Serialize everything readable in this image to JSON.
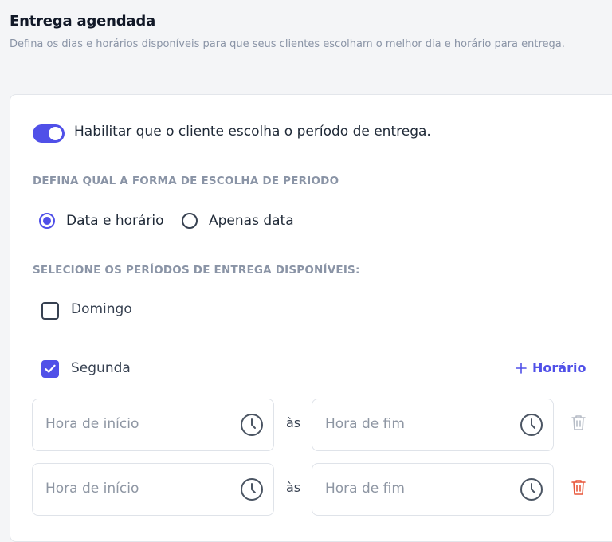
{
  "header": {
    "title": "Entrega agendada",
    "description": "Defina os dias e horários disponíveis para que seus clientes escolham o melhor dia e horário para entrega."
  },
  "toggle": {
    "label": "Habilitar que o cliente escolha o período de entrega.",
    "enabled": true
  },
  "period_form": {
    "heading": "DEFINA QUAL A FORMA DE ESCOLHA DE PERIODO",
    "options": [
      {
        "label": "Data e horário",
        "selected": true
      },
      {
        "label": "Apenas data",
        "selected": false
      }
    ]
  },
  "periods": {
    "heading": "SELECIONE OS PERÍODOS DE ENTREGA DISPONÍVEIS:",
    "days": [
      {
        "label": "Domingo",
        "checked": false
      },
      {
        "label": "Segunda",
        "checked": true
      }
    ],
    "add_time_label": "Horário",
    "time_rows": [
      {
        "start_placeholder": "Hora de início",
        "separator": "às",
        "end_placeholder": "Hora de fim",
        "delete_enabled": false
      },
      {
        "start_placeholder": "Hora de início",
        "separator": "às",
        "end_placeholder": "Hora de fim",
        "delete_enabled": true
      }
    ]
  },
  "colors": {
    "accent": "#5050e8",
    "danger": "#e8573a",
    "muted": "#8a94a6"
  }
}
